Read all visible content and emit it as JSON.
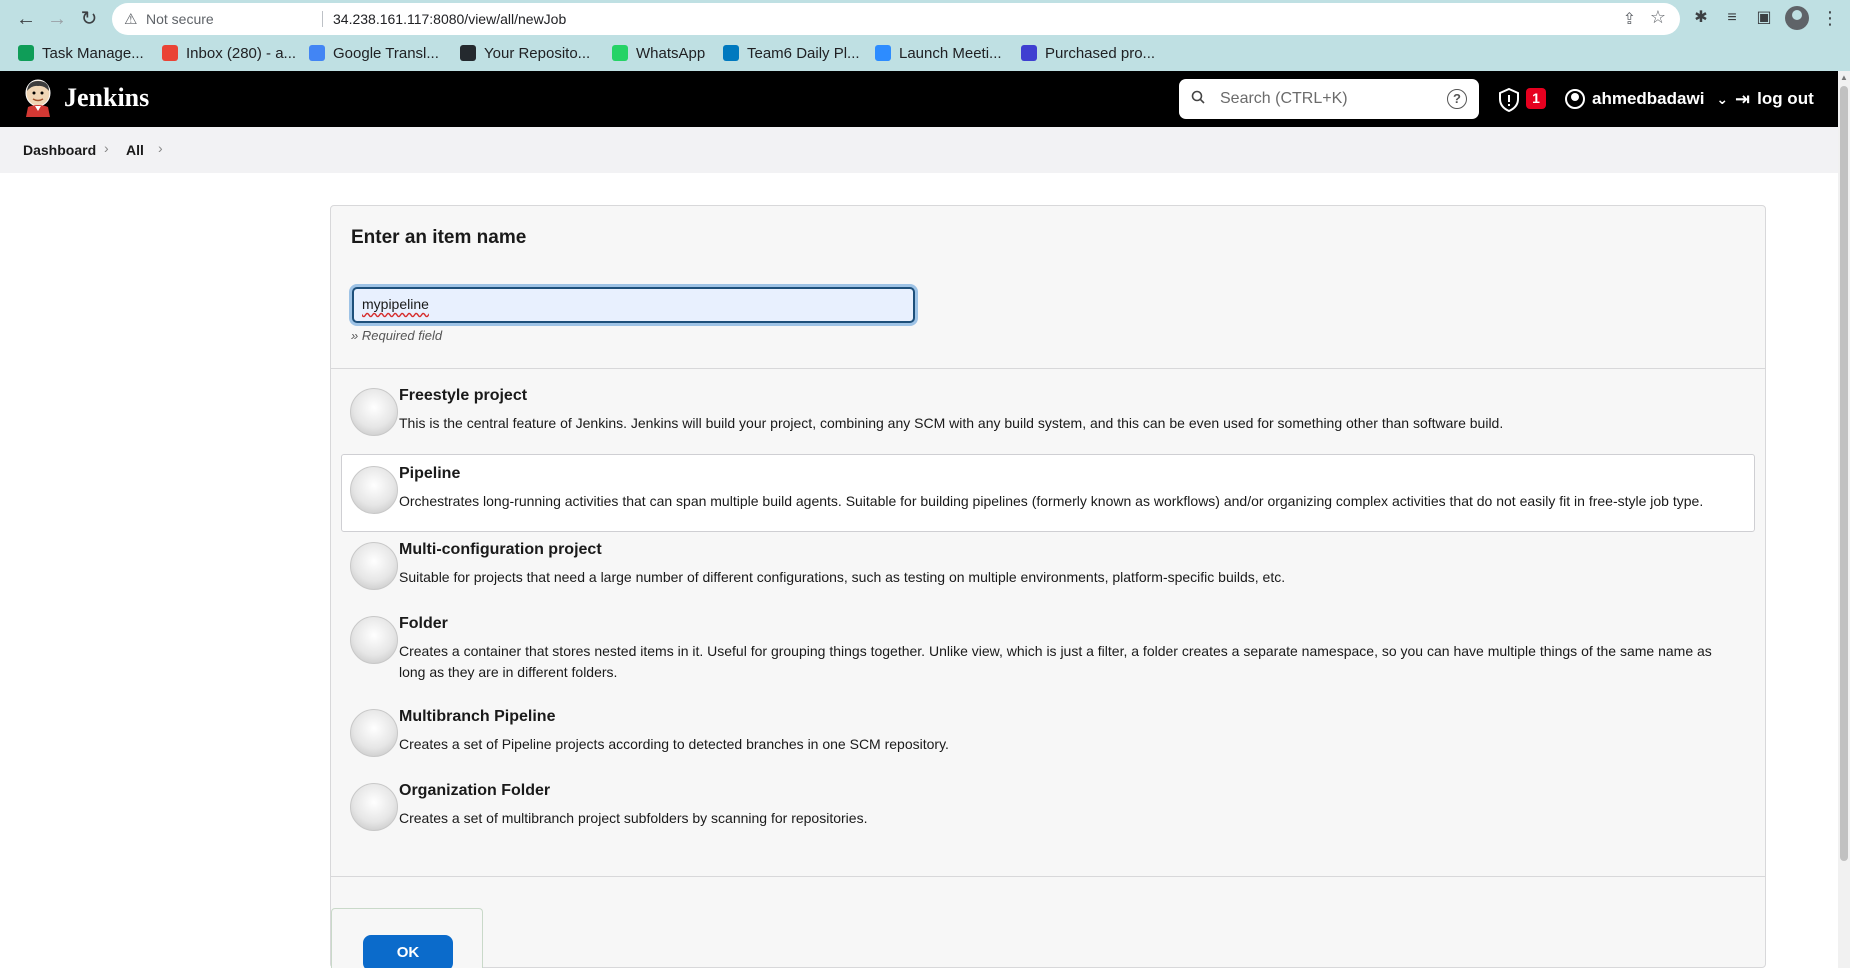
{
  "browser": {
    "not_secure": "Not secure",
    "url": "34.238.161.117:8080/view/all/newJob",
    "bookmarks": [
      {
        "label": "Task Manage...",
        "color": "#0f9d58"
      },
      {
        "label": "Inbox (280) - a...",
        "color": "#ea4335"
      },
      {
        "label": "Google Transl...",
        "color": "#4285f4"
      },
      {
        "label": "Your Reposito...",
        "color": "#24292e"
      },
      {
        "label": "WhatsApp",
        "color": "#25d366"
      },
      {
        "label": "Team6 Daily Pl...",
        "color": "#0079bf"
      },
      {
        "label": "Launch Meeti...",
        "color": "#2d8cff"
      },
      {
        "label": "Purchased pro...",
        "color": "#3f3fd1"
      }
    ]
  },
  "jenkins": {
    "brand": "Jenkins",
    "search_placeholder": "Search (CTRL+K)",
    "help": "?",
    "alert_count": "1",
    "username": "ahmedbadawi",
    "logout": "log out"
  },
  "breadcrumb": {
    "items": [
      "Dashboard",
      "All"
    ]
  },
  "form": {
    "title": "Enter an item name",
    "item_name_value": "mypipeline",
    "required_hint": "» Required field",
    "ok_label": "OK"
  },
  "item_types": [
    {
      "name": "Freestyle project",
      "desc": "This is the central feature of Jenkins. Jenkins will build your project, combining any SCM with any build system, and this can be even used for something other than software build.",
      "icon": "freestyle-box-icon"
    },
    {
      "name": "Pipeline",
      "desc": "Orchestrates long-running activities that can span multiple build agents. Suitable for building pipelines (formerly known as workflows) and/or organizing complex activities that do not easily fit in free-style job type.",
      "icon": "pipeline-pipe-icon",
      "selected": true
    },
    {
      "name": "Multi-configuration project",
      "desc": "Suitable for projects that need a large number of different configurations, such as testing on multiple environments, platform-specific builds, etc.",
      "icon": "multi-config-icon"
    },
    {
      "name": "Folder",
      "desc": "Creates a container that stores nested items in it. Useful for grouping things together. Unlike view, which is just a filter, a folder creates a separate namespace, so you can have multiple things of the same name as long as they are in different folders.",
      "icon": "folder-icon"
    },
    {
      "name": "Multibranch Pipeline",
      "desc": "Creates a set of Pipeline projects according to detected branches in one SCM repository.",
      "icon": "multibranch-icon"
    },
    {
      "name": "Organization Folder",
      "desc": "Creates a set of multibranch project subfolders by scanning for repositories.",
      "icon": "organization-folder-icon"
    }
  ]
}
